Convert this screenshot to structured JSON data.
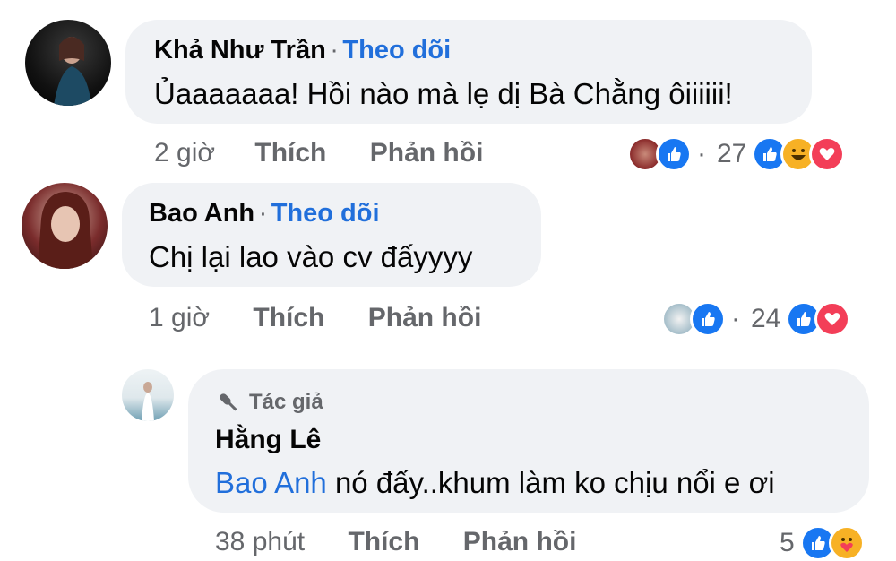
{
  "comments": [
    {
      "author": "Khả Như Trần",
      "follow": "Theo dõi",
      "text": "Ủaaaaaaa! Hồi nào mà lẹ dị Bà Chằng ôiiiiii!",
      "time": "2 giờ",
      "like": "Thích",
      "reply": "Phản hồi",
      "reaction_count": "27"
    },
    {
      "author": "Bao Anh",
      "follow": "Theo dõi",
      "text": "Chị lại lao vào cv đấyyyy",
      "time": "1 giờ",
      "like": "Thích",
      "reply": "Phản hồi",
      "reaction_count": "24"
    }
  ],
  "reply": {
    "badge": "Tác giả",
    "author": "Hằng Lê",
    "mention": "Bao Anh",
    "text": " nó đấy..khum làm ko chịu nổi e ơi",
    "time": "38 phút",
    "like": "Thích",
    "reply": "Phản hồi",
    "reaction_count": "5"
  },
  "colors": {
    "accent": "#216fdb",
    "bubble": "#f0f2f5",
    "muted": "#65676b"
  },
  "separator": "·"
}
